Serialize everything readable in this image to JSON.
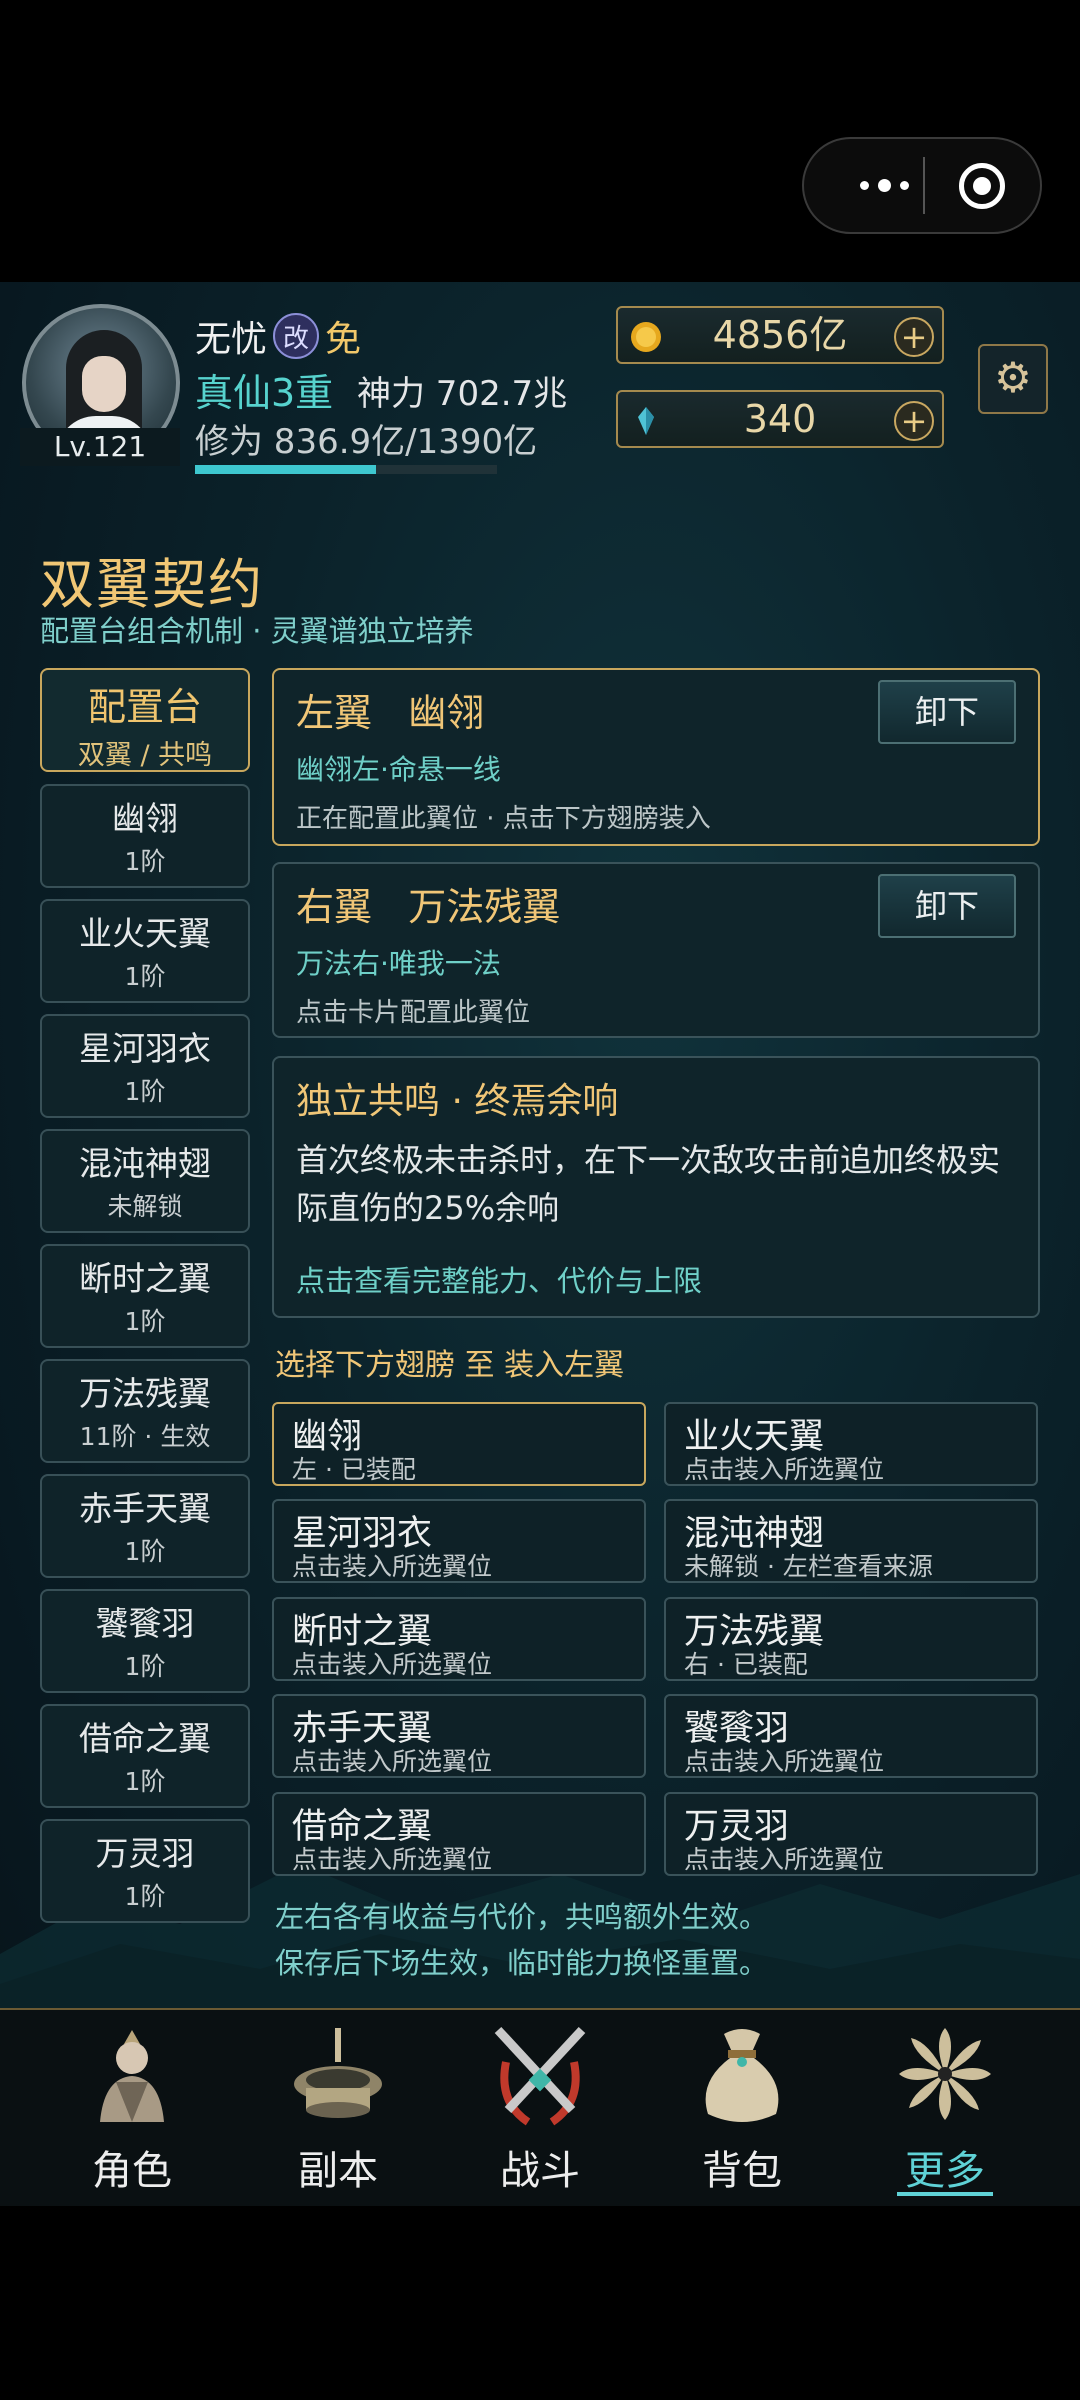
{
  "mini_program_capsule": {
    "more_icon": "more-dots-icon",
    "close_icon": "target-close-icon"
  },
  "player": {
    "name": "无忧",
    "badge1": "改",
    "badge2": "免",
    "realm": "真仙3重",
    "power": "神力 702.7兆",
    "cultivation": "修为 836.9亿/1390亿",
    "cultivation_progress": 0.6,
    "level": "Lv.121"
  },
  "currency": {
    "gold": "4856亿",
    "crystal": "340",
    "plus": "+",
    "gold_color": "#e6a81e",
    "crystal_color": "#4fc3d6"
  },
  "page": {
    "title": "双翼契约",
    "subtitle": "配置台组合机制 · 灵翼谱独立培养"
  },
  "sidebar": {
    "config": {
      "label": "配置台",
      "sub": "双翼 / 共鸣"
    },
    "items": [
      {
        "name": "幽翎",
        "sub": "1阶"
      },
      {
        "name": "业火天翼",
        "sub": "1阶"
      },
      {
        "name": "星河羽衣",
        "sub": "1阶"
      },
      {
        "name": "混沌神翅",
        "sub": "未解锁"
      },
      {
        "name": "断时之翼",
        "sub": "1阶"
      },
      {
        "name": "万法残翼",
        "sub": "11阶 · 生效"
      },
      {
        "name": "赤手天翼",
        "sub": "1阶"
      },
      {
        "name": "饕餮羽",
        "sub": "1阶"
      },
      {
        "name": "借命之翼",
        "sub": "1阶"
      },
      {
        "name": "万灵羽",
        "sub": "1阶"
      }
    ]
  },
  "left_wing": {
    "slot": "左翼",
    "name": "幽翎",
    "desc": "幽翎左·命悬一线",
    "hint": "正在配置此翼位 · 点击下方翅膀装入",
    "button": "卸下"
  },
  "right_wing": {
    "slot": "右翼",
    "name": "万法残翼",
    "desc": "万法右·唯我一法",
    "hint": "点击卡片配置此翼位",
    "button": "卸下"
  },
  "resonance": {
    "title": "独立共鸣 · 终焉余响",
    "body": "首次终极未击杀时，在下一次敌攻击前追加终极实际直伤的25%余响",
    "link": "点击查看完整能力、代价与上限"
  },
  "picker": {
    "title": "选择下方翅膀 至 装入左翼",
    "wings": [
      {
        "name": "幽翎",
        "sub": "左 · 已装配"
      },
      {
        "name": "业火天翼",
        "sub": "点击装入所选翼位"
      },
      {
        "name": "星河羽衣",
        "sub": "点击装入所选翼位"
      },
      {
        "name": "混沌神翅",
        "sub": "未解锁 · 左栏查看来源"
      },
      {
        "name": "断时之翼",
        "sub": "点击装入所选翼位"
      },
      {
        "name": "万法残翼",
        "sub": "右 · 已装配"
      },
      {
        "name": "赤手天翼",
        "sub": "点击装入所选翼位"
      },
      {
        "name": "饕餮羽",
        "sub": "点击装入所选翼位"
      },
      {
        "name": "借命之翼",
        "sub": "点击装入所选翼位"
      },
      {
        "name": "万灵羽",
        "sub": "点击装入所选翼位"
      }
    ]
  },
  "footer": {
    "line1": "左右各有收益与代价，共鸣额外生效。",
    "line2": "保存后下场生效，临时能力换怪重置。"
  },
  "nav": {
    "items": [
      {
        "label": "角色",
        "icon": "character-icon"
      },
      {
        "label": "副本",
        "icon": "dungeon-icon"
      },
      {
        "label": "战斗",
        "icon": "battle-swords-icon"
      },
      {
        "label": "背包",
        "icon": "bag-icon"
      },
      {
        "label": "更多",
        "icon": "more-flower-icon"
      }
    ],
    "active_index": 4,
    "active_color": "#5fd2d6"
  }
}
